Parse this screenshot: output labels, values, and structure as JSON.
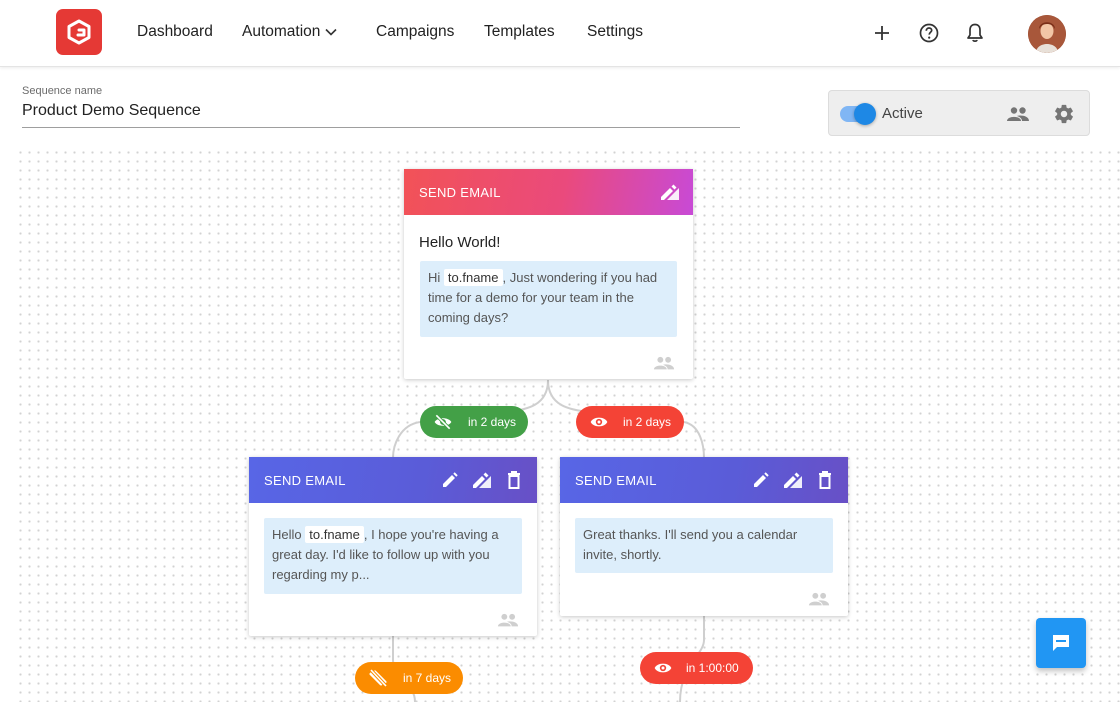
{
  "nav": {
    "logo_icon": "brand-logo",
    "items": [
      "Dashboard",
      "Automation",
      "Campaigns",
      "Templates",
      "Settings"
    ],
    "right_icons": [
      "plus-icon",
      "help-icon",
      "bell-icon"
    ]
  },
  "sequence": {
    "label": "Sequence name",
    "name": "Product Demo Sequence"
  },
  "status": {
    "label": "Active",
    "enabled": true,
    "icons": [
      "people-icon",
      "gear-icon"
    ]
  },
  "cards": {
    "root": {
      "header": "SEND EMAIL",
      "subject": "Hello World!",
      "body_pre": "Hi",
      "tag": "to.fname",
      "body_post": ", Just wondering if you had time for a demo for your team in the coming days?"
    },
    "left": {
      "header": "SEND EMAIL",
      "body_pre": "Hello",
      "tag": "to.fname",
      "body_post": ", I hope you're having a great day. I'd like to follow up with you regarding my p..."
    },
    "right": {
      "header": "SEND EMAIL",
      "body": "Great thanks. I'll send you a calendar invite, shortly."
    }
  },
  "pills": {
    "not_opened": "in 2 days",
    "opened": "in 2 days",
    "not_clicked": "in 7 days",
    "opened_later": "in 1:00:00"
  },
  "colors": {
    "brand": "#e53935",
    "accent": "#1e88e5",
    "green": "#43a047",
    "red": "#f44336",
    "orange": "#fb8c00",
    "card_red_header": "#f25257",
    "card_purple_header": "#5866e6",
    "message_bg": "#ddeefb"
  }
}
